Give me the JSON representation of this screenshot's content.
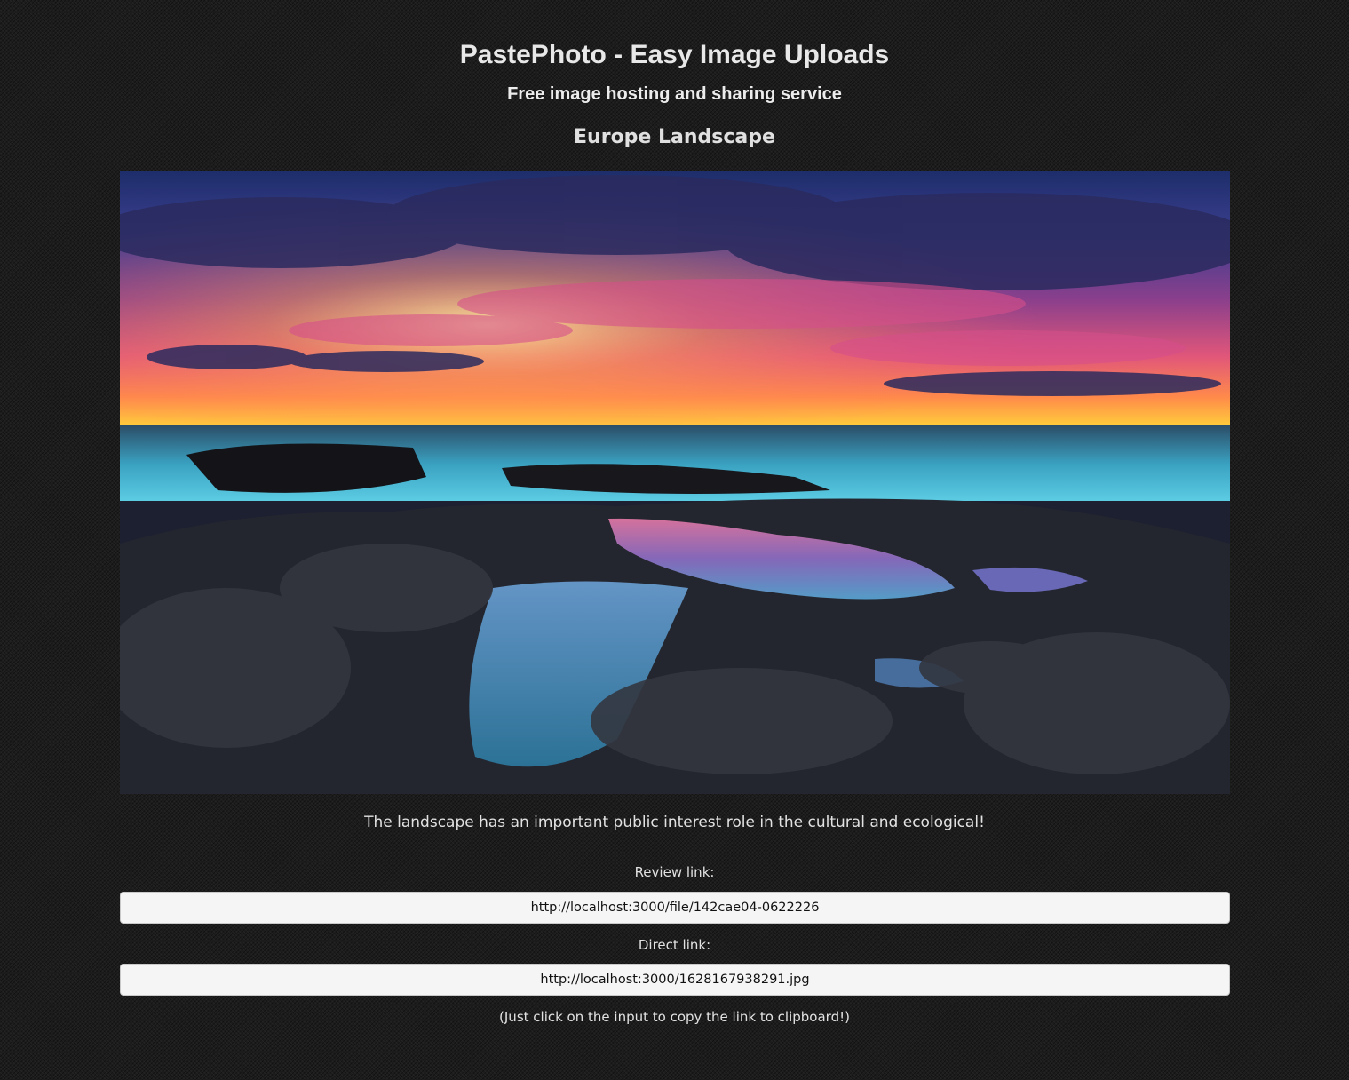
{
  "header": {
    "title": "PastePhoto - Easy Image Uploads",
    "subtitle": "Free image hosting and sharing service"
  },
  "image": {
    "title": "Europe Landscape",
    "caption": "The landscape has an important public interest role in the cultural and ecological!"
  },
  "links": {
    "review_label": "Review link:",
    "review_value": "http://localhost:3000/file/142cae04-0622226",
    "direct_label": "Direct link:",
    "direct_value": "http://localhost:3000/1628167938291.jpg",
    "hint": "(Just click on the input to copy the link to clipboard!)"
  },
  "colors": {
    "background": "#1c1c1c",
    "input_background": "#f5f5f5",
    "text": "#e6e6e6"
  }
}
